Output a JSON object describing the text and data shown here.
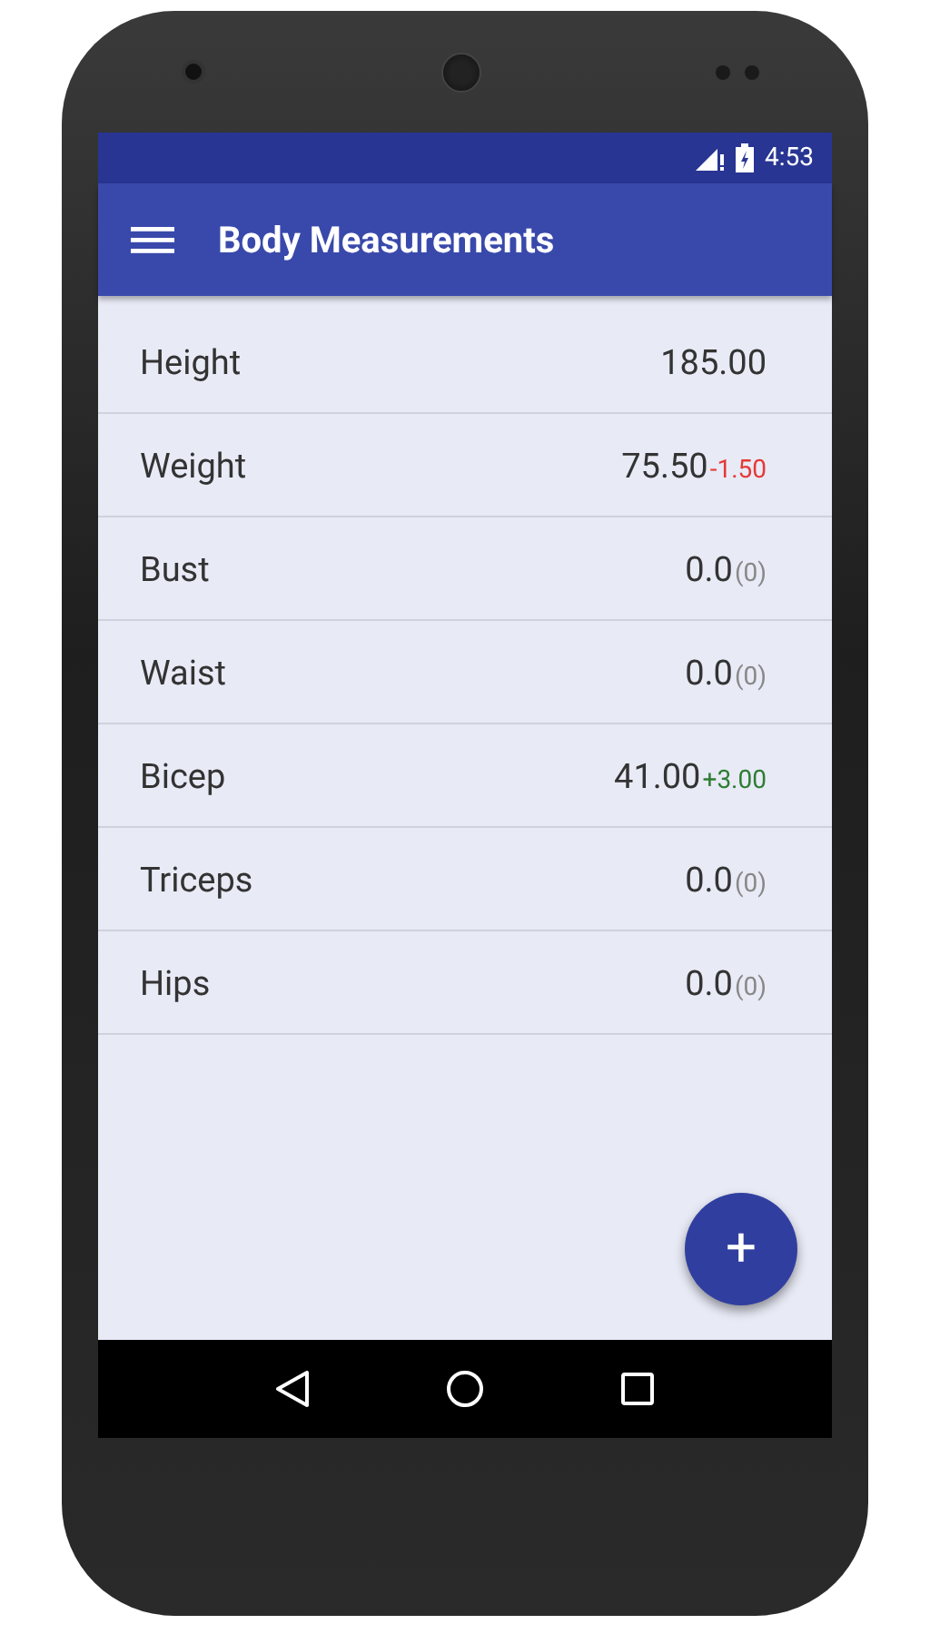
{
  "status_bar": {
    "time": "4:53"
  },
  "app_bar": {
    "title": "Body Measurements"
  },
  "measurements": [
    {
      "name": "Height",
      "value": "185.00"
    },
    {
      "name": "Weight",
      "value": "75.50",
      "change": {
        "text": "-1.50",
        "kind": "down"
      }
    },
    {
      "name": "Bust",
      "value": "0.0",
      "change": {
        "text": "(0)",
        "kind": "none"
      }
    },
    {
      "name": "Waist",
      "value": "0.0",
      "change": {
        "text": "(0)",
        "kind": "none"
      }
    },
    {
      "name": "Bicep",
      "value": "41.00",
      "change": {
        "text": "+3.00",
        "kind": "up"
      }
    },
    {
      "name": "Triceps",
      "value": "0.0",
      "change": {
        "text": "(0)",
        "kind": "none"
      }
    },
    {
      "name": "Hips",
      "value": "0.0",
      "change": {
        "text": "(0)",
        "kind": "none"
      }
    }
  ],
  "fab": {
    "label": "+"
  }
}
